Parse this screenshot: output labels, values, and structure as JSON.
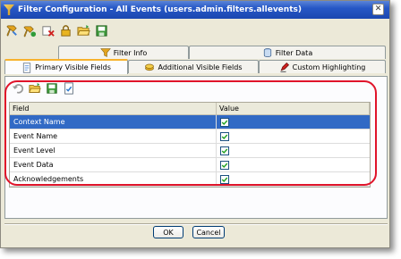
{
  "window": {
    "title": "Filter Configuration - All Events (users.admin.filters.allevents)"
  },
  "toolbar": {
    "items": [
      {
        "icon": "pin-icon"
      },
      {
        "icon": "copy-pin-icon"
      },
      {
        "icon": "delete-icon"
      },
      {
        "icon": "lock-icon"
      },
      {
        "icon": "open-folder-icon"
      },
      {
        "icon": "save-icon"
      }
    ]
  },
  "tabs": {
    "row1": [
      {
        "label": "Filter Info",
        "icon": "funnel-icon"
      },
      {
        "label": "Filter Data",
        "icon": "database-icon"
      }
    ],
    "row2": [
      {
        "label": "Primary Visible Fields",
        "icon": "document-icon",
        "active": true
      },
      {
        "label": "Additional Visible Fields",
        "icon": "coins-icon"
      },
      {
        "label": "Custom Highlighting",
        "icon": "highlighter-icon"
      }
    ]
  },
  "panel_toolbar": {
    "items": [
      {
        "icon": "undo-icon"
      },
      {
        "icon": "open-folder-icon"
      },
      {
        "icon": "save-icon"
      },
      {
        "icon": "apply-icon"
      }
    ]
  },
  "table": {
    "columns": [
      "Field",
      "Value"
    ],
    "rows": [
      {
        "field": "Context Name",
        "checked": true,
        "selected": true
      },
      {
        "field": "Event Name",
        "checked": true
      },
      {
        "field": "Event Level",
        "checked": true
      },
      {
        "field": "Event Data",
        "checked": true
      },
      {
        "field": "Acknowledgements",
        "checked": true
      }
    ]
  },
  "buttons": {
    "ok": "OK",
    "cancel": "Cancel"
  },
  "colors": {
    "title_bar": "#2657c6",
    "selection": "#316ac5",
    "highlight_outline": "#e0142a",
    "active_tab_accent": "#f7b22d"
  }
}
